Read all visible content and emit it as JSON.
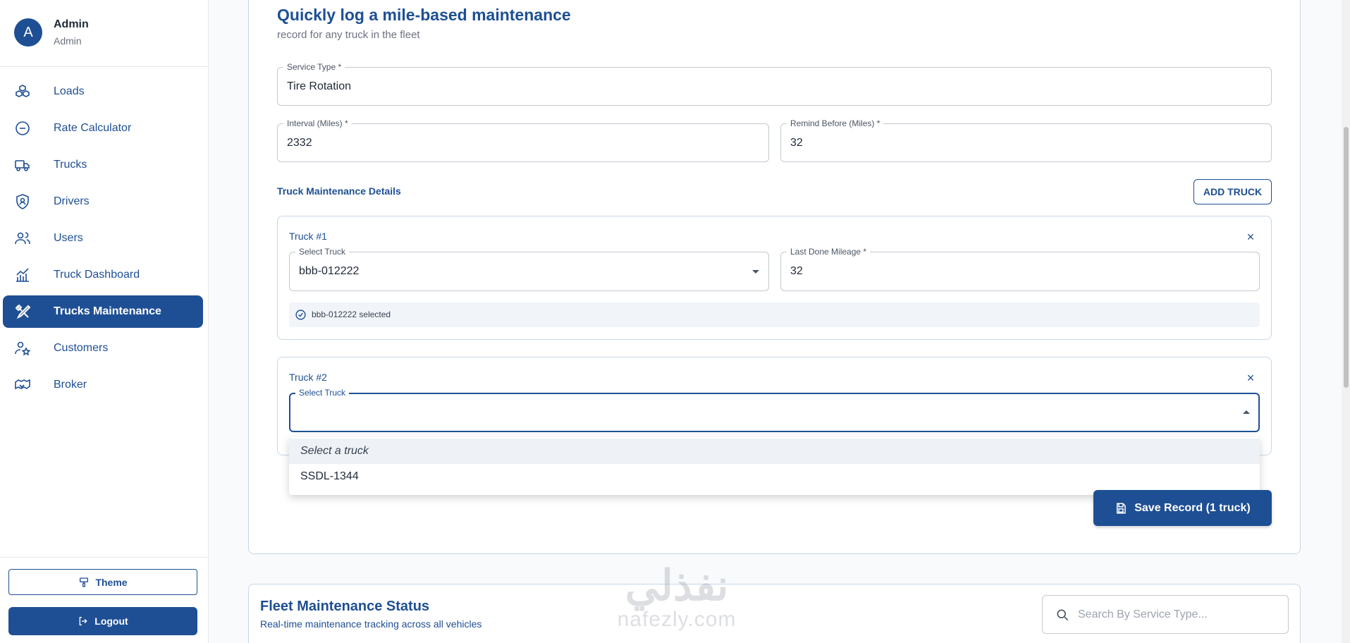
{
  "user": {
    "avatar_letter": "A",
    "name": "Admin",
    "role": "Admin"
  },
  "sidebar": {
    "items": [
      {
        "label": "Loads",
        "icon": "boxes-icon"
      },
      {
        "label": "Rate Calculator",
        "icon": "calculator-icon"
      },
      {
        "label": "Trucks",
        "icon": "truck-icon"
      },
      {
        "label": "Drivers",
        "icon": "shield-user-icon"
      },
      {
        "label": "Users",
        "icon": "users-icon"
      },
      {
        "label": "Truck Dashboard",
        "icon": "chart-icon"
      },
      {
        "label": "Trucks Maintenance",
        "icon": "tools-icon",
        "active": true
      },
      {
        "label": "Customers",
        "icon": "user-star-icon"
      },
      {
        "label": "Broker",
        "icon": "handshake-icon"
      }
    ],
    "theme_label": "Theme",
    "logout_label": "Logout"
  },
  "form": {
    "title": "Quickly log a mile-based maintenance",
    "subtitle": "record for any truck in the fleet",
    "service_type": {
      "label": "Service Type *",
      "value": "Tire Rotation"
    },
    "interval": {
      "label": "Interval (Miles) *",
      "value": "2332"
    },
    "remind_before": {
      "label": "Remind Before (Miles) *",
      "value": "32"
    },
    "section_title": "Truck Maintenance Details",
    "add_truck_label": "ADD TRUCK",
    "truck1": {
      "title": "Truck #1",
      "select_label": "Select Truck",
      "select_value": "bbb-012222",
      "mileage_label": "Last Done Mileage *",
      "mileage_value": "32",
      "selected_note": "bbb-012222 selected"
    },
    "truck2": {
      "title": "Truck #2",
      "select_label": "Select Truck",
      "select_value": ""
    },
    "dropdown": {
      "options": [
        "Select a truck",
        "SSDL-1344"
      ]
    },
    "save_label": "Save Record (1 truck)"
  },
  "fleet": {
    "title": "Fleet Maintenance Status",
    "subtitle": "Real-time maintenance tracking across all vehicles",
    "search_placeholder": "Search By Service Type..."
  },
  "watermark": {
    "arabic": "نفذلي",
    "latin": "nafezly.com"
  },
  "colors": {
    "primary": "#1e4f94",
    "border": "#c7d7e8",
    "muted": "#6b7280"
  }
}
